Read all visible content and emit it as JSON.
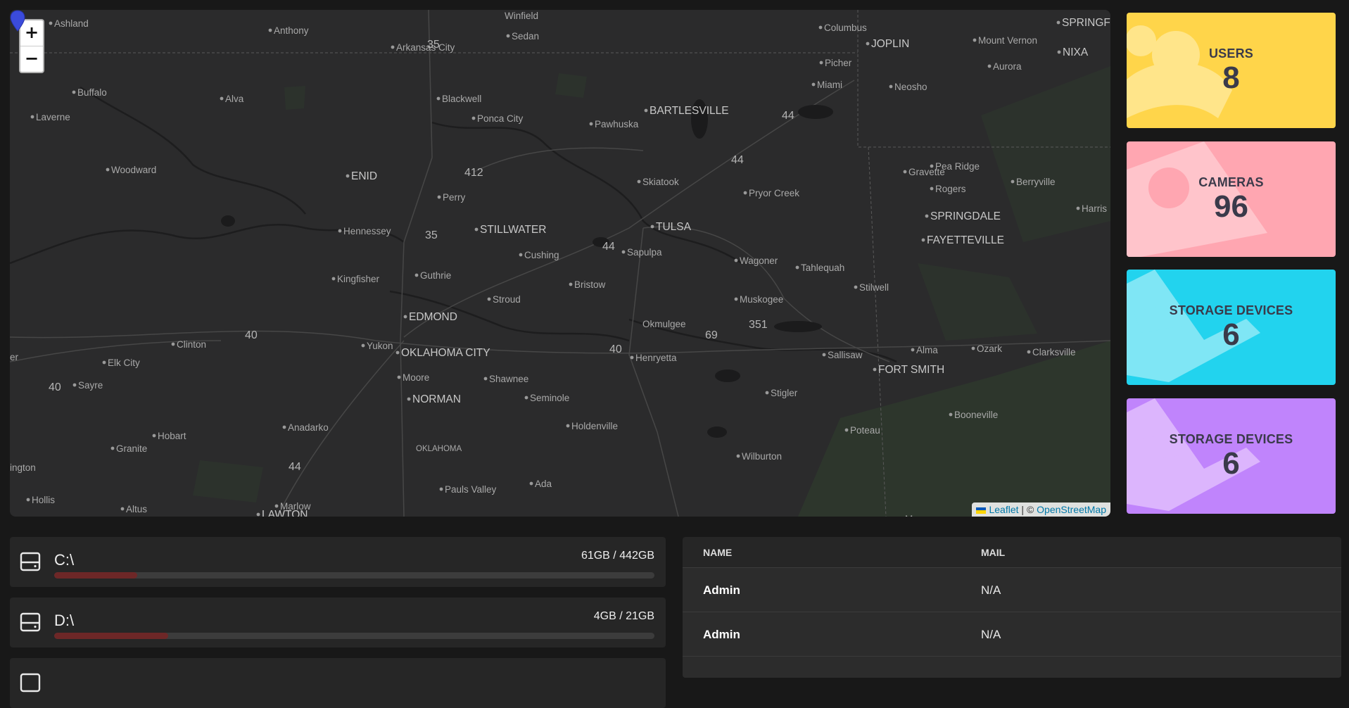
{
  "map": {
    "zoom_in_label": "+",
    "zoom_out_label": "−",
    "attribution": {
      "leaflet": "Leaflet",
      "separator": " | © ",
      "osm": "OpenStreetMap"
    },
    "labels": [
      {
        "text": "Ashland",
        "size": "small"
      },
      {
        "text": "Winfield",
        "size": "small"
      },
      {
        "text": "Anthony",
        "size": "small"
      },
      {
        "text": "Arkansas City",
        "size": "small"
      },
      {
        "text": "Sedan",
        "size": "small"
      },
      {
        "text": "Columbus",
        "size": "small"
      },
      {
        "text": "JOPLIN",
        "size": "mid"
      },
      {
        "text": "Mount Vernon",
        "size": "small"
      },
      {
        "text": "SPRINGFIEL",
        "size": "mid"
      },
      {
        "text": "Picher",
        "size": "small"
      },
      {
        "text": "Aurora",
        "size": "small"
      },
      {
        "text": "NIXA",
        "size": "mid"
      },
      {
        "text": "Miami",
        "size": "small"
      },
      {
        "text": "Neosho",
        "size": "small"
      },
      {
        "text": "Buffalo",
        "size": "small"
      },
      {
        "text": "Alva",
        "size": "small"
      },
      {
        "text": "Blackwell",
        "size": "small"
      },
      {
        "text": "BARTLESVILLE",
        "size": "mid"
      },
      {
        "text": "Laverne",
        "size": "small"
      },
      {
        "text": "Ponca City",
        "size": "small"
      },
      {
        "text": "Pawhuska",
        "size": "small"
      },
      {
        "text": "Woodward",
        "size": "small"
      },
      {
        "text": "Pea Ridge",
        "size": "small"
      },
      {
        "text": "Gravette",
        "size": "small"
      },
      {
        "text": "ENID",
        "size": "mid"
      },
      {
        "text": "Skiatook",
        "size": "small"
      },
      {
        "text": "Rogers",
        "size": "small"
      },
      {
        "text": "Berryville",
        "size": "small"
      },
      {
        "text": "Perry",
        "size": "small"
      },
      {
        "text": "Pryor Creek",
        "size": "small"
      },
      {
        "text": "Harris",
        "size": "small"
      },
      {
        "text": "SPRINGDALE",
        "size": "mid"
      },
      {
        "text": "TULSA",
        "size": "mid"
      },
      {
        "text": "Hennessey",
        "size": "small"
      },
      {
        "text": "STILLWATER",
        "size": "mid"
      },
      {
        "text": "FAYETTEVILLE",
        "size": "mid"
      },
      {
        "text": "Sapulpa",
        "size": "small"
      },
      {
        "text": "Cushing",
        "size": "small"
      },
      {
        "text": "Wagoner",
        "size": "small"
      },
      {
        "text": "Tahlequah",
        "size": "small"
      },
      {
        "text": "Guthrie",
        "size": "small"
      },
      {
        "text": "Kingfisher",
        "size": "small"
      },
      {
        "text": "Bristow",
        "size": "small"
      },
      {
        "text": "Stilwell",
        "size": "small"
      },
      {
        "text": "Stroud",
        "size": "small"
      },
      {
        "text": "Muskogee",
        "size": "small"
      },
      {
        "text": "EDMOND",
        "size": "mid"
      },
      {
        "text": "Okmulgee",
        "size": "small"
      },
      {
        "text": "Clinton",
        "size": "small"
      },
      {
        "text": "Yukon",
        "size": "small"
      },
      {
        "text": "OKLAHOMA CITY",
        "size": "mid"
      },
      {
        "text": "Sallisaw",
        "size": "small"
      },
      {
        "text": "Alma",
        "size": "small"
      },
      {
        "text": "Ozark",
        "size": "small"
      },
      {
        "text": "Clarksville",
        "size": "small"
      },
      {
        "text": "Elk City",
        "size": "small"
      },
      {
        "text": "Henryetta",
        "size": "small"
      },
      {
        "text": "FORT SMITH",
        "size": "mid"
      },
      {
        "text": "Moore",
        "size": "small"
      },
      {
        "text": "Shawnee",
        "size": "small"
      },
      {
        "text": "Sayre",
        "size": "small"
      },
      {
        "text": "NORMAN",
        "size": "mid"
      },
      {
        "text": "Stigler",
        "size": "small"
      },
      {
        "text": "Seminole",
        "size": "small"
      },
      {
        "text": "Booneville",
        "size": "small"
      },
      {
        "text": "Hobart",
        "size": "small"
      },
      {
        "text": "Anadarko",
        "size": "small"
      },
      {
        "text": "Holdenville",
        "size": "small"
      },
      {
        "text": "Poteau",
        "size": "small"
      },
      {
        "text": "Granite",
        "size": "small"
      },
      {
        "text": "OKLAHOMA",
        "size": "tiny"
      },
      {
        "text": "Wilburton",
        "size": "small"
      },
      {
        "text": "ington",
        "size": "small"
      },
      {
        "text": "Ada",
        "size": "small"
      },
      {
        "text": "Pauls Valley",
        "size": "small"
      },
      {
        "text": "Hollis",
        "size": "small"
      },
      {
        "text": "Altus",
        "size": "small"
      },
      {
        "text": "Marlow",
        "size": "small"
      },
      {
        "text": "LAWTON",
        "size": "mid"
      },
      {
        "text": "Mena",
        "size": "small"
      },
      {
        "text": "er",
        "size": "small"
      }
    ],
    "route_labels": [
      "35",
      "412",
      "44",
      "44",
      "35",
      "44",
      "40",
      "40",
      "69",
      "351",
      "40",
      "44"
    ]
  },
  "cards": [
    {
      "title": "USERS",
      "value": "8",
      "color": "#ffd54a",
      "icon": "users-icon"
    },
    {
      "title": "CAMERAS",
      "value": "96",
      "color": "#ffa6b1",
      "icon": "camera-icon"
    },
    {
      "title": "STORAGE DEVICES",
      "value": "6",
      "color": "#22d3ee",
      "icon": "storage-icon"
    },
    {
      "title": "STORAGE DEVICES",
      "value": "6",
      "color": "#c084fc",
      "icon": "storage-icon"
    }
  ],
  "drives": [
    {
      "name": "C:\\",
      "usage": "61GB / 442GB",
      "fraction": 0.138,
      "icon": "harddrive-icon"
    },
    {
      "name": "D:\\",
      "usage": "4GB / 21GB",
      "fraction": 0.19,
      "icon": "harddrive-icon"
    }
  ],
  "table": {
    "headers": {
      "name": "NAME",
      "mail": "MAIL"
    },
    "rows": [
      {
        "name": "Admin",
        "mail": "N/A"
      },
      {
        "name": "Admin",
        "mail": "N/A"
      }
    ]
  }
}
